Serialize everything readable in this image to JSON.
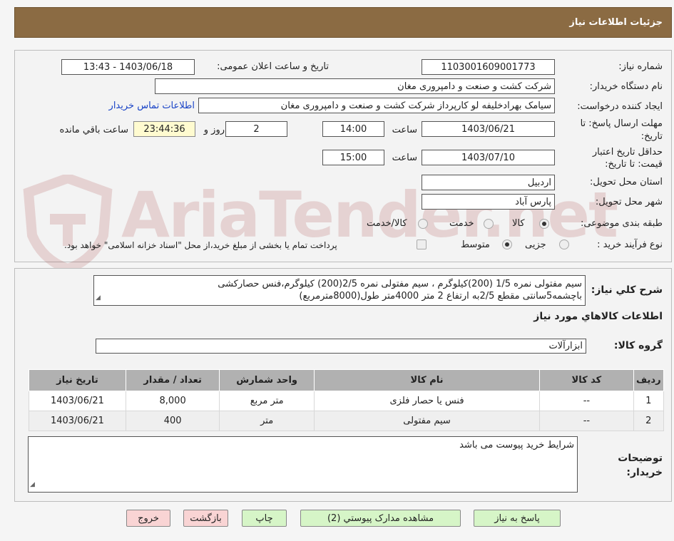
{
  "header": {
    "title": "جزئیات اطلاعات نیاز"
  },
  "watermark": {
    "text": "AriaTender.net"
  },
  "form": {
    "need_number_label": "شماره نیاز:",
    "need_number": "1103001609001773",
    "announce_label": "تاریخ و ساعت اعلان عمومی:",
    "announce_value": "1403/06/18 - 13:43",
    "buyer_org_label": "نام دستگاه خریدار:",
    "buyer_org": "شرکت کشت و صنعت و دامپروری مغان",
    "creator_label": "ایجاد کننده درخواست:",
    "creator": "سیامک بهرادخلیفه لو کارپرداز شرکت کشت و صنعت و دامپروری مغان",
    "contact_link": "اطلاعات تماس خریدار",
    "deadline_label": "مهلت ارسال پاسخ: تا تاریخ:",
    "deadline_date": "1403/06/21",
    "time_label": "ساعت",
    "deadline_time": "14:00",
    "days": "2",
    "days_label": "روز و",
    "remaining": "23:44:36",
    "remaining_label": "ساعت باقي مانده",
    "validity_label": "حداقل تاریخ اعتبار قیمت: تا تاریخ:",
    "validity_date": "1403/07/10",
    "validity_time": "15:00",
    "province_label": "استان محل تحویل:",
    "province": "اردبیل",
    "city_label": "شهر محل تحویل:",
    "city": "پارس آباد",
    "category_label": "طبقه بندی موضوعی:",
    "category_options": [
      "کالا",
      "خدمت",
      "کالا/خدمت"
    ],
    "process_label": "نوع فرآیند خرید :",
    "process_options": [
      "جزیی",
      "متوسط"
    ],
    "payment_note": "پرداخت تمام یا بخشی از مبلغ خرید،از محل \"اسناد خزانه اسلامی\" خواهد بود."
  },
  "details": {
    "summary_label": "شرح کلي نياز:",
    "summary_line1": "سیم مفتولی نمره 1/5 (200)کیلوگرم ، سیم مفتولی نمره 2/5(200) کیلوگرم،فنس حصارکشی",
    "summary_line2": "باچشمه5سانتی مقطع 2/5به ارتفاع 2 متر 4000متر طول(8000مترمربع)",
    "goods_info_title": "اطلاعات کالاهاي مورد نياز",
    "group_label": "گروه کالا:",
    "group_value": "ابزارآلات",
    "table": {
      "headers": [
        "رديف",
        "کد کالا",
        "نام کالا",
        "واحد شمارش",
        "تعداد / مقدار",
        "تاریخ نیاز"
      ],
      "rows": [
        [
          "1",
          "--",
          "فنس یا حصار فلزی",
          "متر مربع",
          "8,000",
          "1403/06/21"
        ],
        [
          "2",
          "--",
          "سیم مفتولی",
          "متر",
          "400",
          "1403/06/21"
        ]
      ]
    },
    "buyer_notes_label_1": "توضیحات",
    "buyer_notes_label_2": "خریدار:",
    "buyer_notes": "شرایط خرید پیوست می باشد"
  },
  "buttons": {
    "reply": "پاسخ به نیاز",
    "attachments": "مشاهده مدارک پیوستي (2)",
    "print": "چاپ",
    "back": "بازگشت",
    "exit": "خروج"
  }
}
